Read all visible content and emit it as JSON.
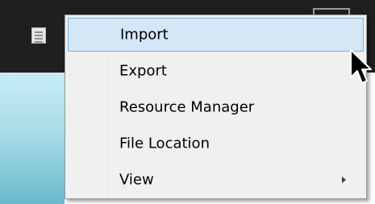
{
  "toolbar": {
    "icon": "document-icon"
  },
  "menu": {
    "items": [
      {
        "label": "Import",
        "highlighted": true,
        "has_submenu": false
      },
      {
        "label": "Export",
        "highlighted": false,
        "has_submenu": false
      },
      {
        "label": "Resource Manager",
        "highlighted": false,
        "has_submenu": false
      },
      {
        "label": "File Location",
        "highlighted": false,
        "has_submenu": false
      },
      {
        "label": "View",
        "highlighted": false,
        "has_submenu": true
      }
    ]
  },
  "colors": {
    "highlight_fill": "#d5e6f7",
    "highlight_border": "#7ab4e6",
    "menu_background": "#f0f0f0",
    "toolbar_background": "#1f1f1f"
  },
  "cursor": {
    "icon": "arrow-pointer-icon"
  }
}
